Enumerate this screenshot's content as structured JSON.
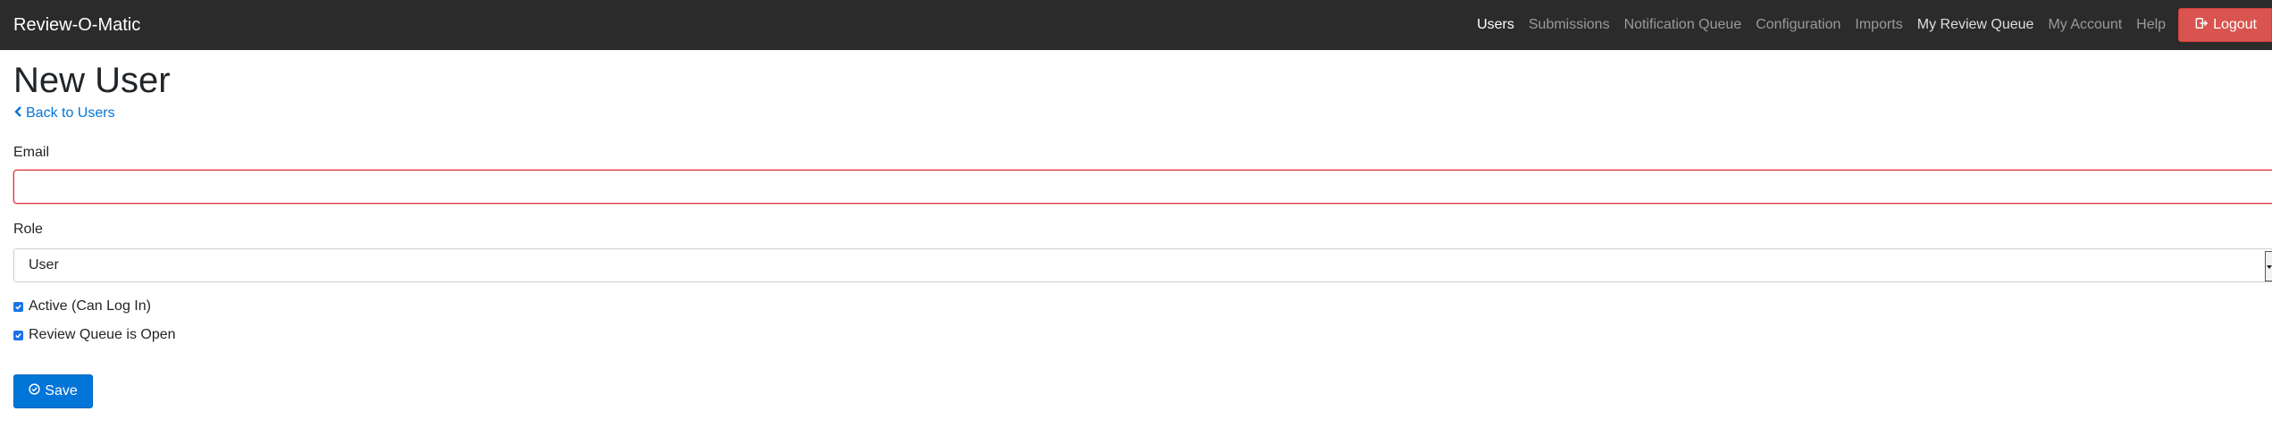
{
  "navbar": {
    "brand": "Review-O-Matic",
    "links": [
      {
        "label": "Users",
        "state": "active"
      },
      {
        "label": "Submissions",
        "state": "inactive"
      },
      {
        "label": "Notification Queue",
        "state": "inactive"
      },
      {
        "label": "Configuration",
        "state": "inactive"
      },
      {
        "label": "Imports",
        "state": "inactive"
      },
      {
        "label": "My Review Queue",
        "state": "light"
      },
      {
        "label": "My Account",
        "state": "inactive"
      },
      {
        "label": "Help",
        "state": "inactive"
      }
    ],
    "logout_label": "Logout",
    "logout_icon": "sign-out-icon",
    "colors": {
      "background": "#2b2b2b",
      "logout": "#d9534f"
    }
  },
  "page": {
    "title": "New User",
    "back_link": "Back to Users",
    "back_icon": "chevron-left-icon"
  },
  "form": {
    "email_label": "Email",
    "email_value": "",
    "email_invalid": true,
    "role_label": "Role",
    "role_selected": "User",
    "checkboxes": [
      {
        "label": "Active (Can Log In)",
        "checked": true
      },
      {
        "label": "Review Queue is Open",
        "checked": true
      }
    ],
    "save_label": "Save",
    "save_icon": "check-circle-icon"
  },
  "colors": {
    "primary": "#0275d8",
    "danger": "#dc3545",
    "checkbox": "#1a73e8"
  }
}
